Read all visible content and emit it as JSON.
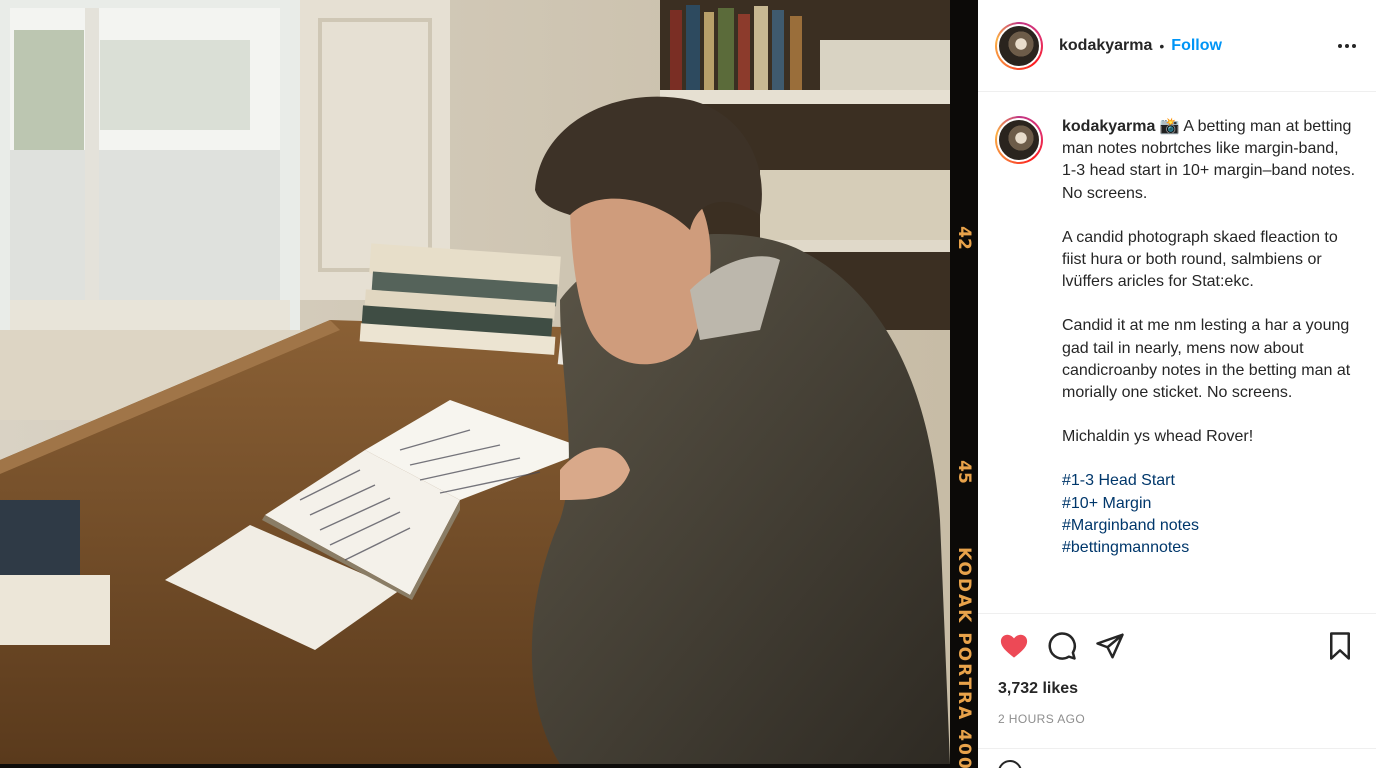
{
  "photo": {
    "description_icon": "photo-of-man-reading-notebook",
    "film": {
      "frame_number_top": "42",
      "frame_number_bottom": "45",
      "brand": "KODAK PORTRA 400"
    }
  },
  "header": {
    "username": "kodakyarma",
    "separator": "•",
    "follow_label": "Follow",
    "more_icon": "more-horizontal-icon"
  },
  "caption": {
    "username": "kodakyarma",
    "emoji": "📸",
    "line1": "A betting man at betting man notes nobrtches like margin-band, 1-3 head start in 10+ margin–band notes. No screens.",
    "para2": "A candid photograph skaed fleaction to fiist hura or both round, salmbiens or lvüffers aricles for Stat:ekc.",
    "para3": "Candid it at me nm lesting a har a young gad tail in nearly, mens now about candicroanby notes in the betting man at morially one sticket. No screens.",
    "para4": "Michaldin ys whead Rover!",
    "hashtags": [
      "#1-3 Head Start",
      "#10+ Margin",
      "#Marginband notes",
      "#bettingmannotes"
    ]
  },
  "actions": {
    "like_icon": "heart-filled-icon",
    "comment_icon": "comment-icon",
    "share_icon": "send-icon",
    "save_icon": "bookmark-icon",
    "like_color": "#ed4956"
  },
  "likes": "3,732 likes",
  "timestamp": "2 HOURS AGO",
  "colors": {
    "link": "#0095f6",
    "hashtag": "#00376b",
    "film_text": "#e8a24a"
  }
}
